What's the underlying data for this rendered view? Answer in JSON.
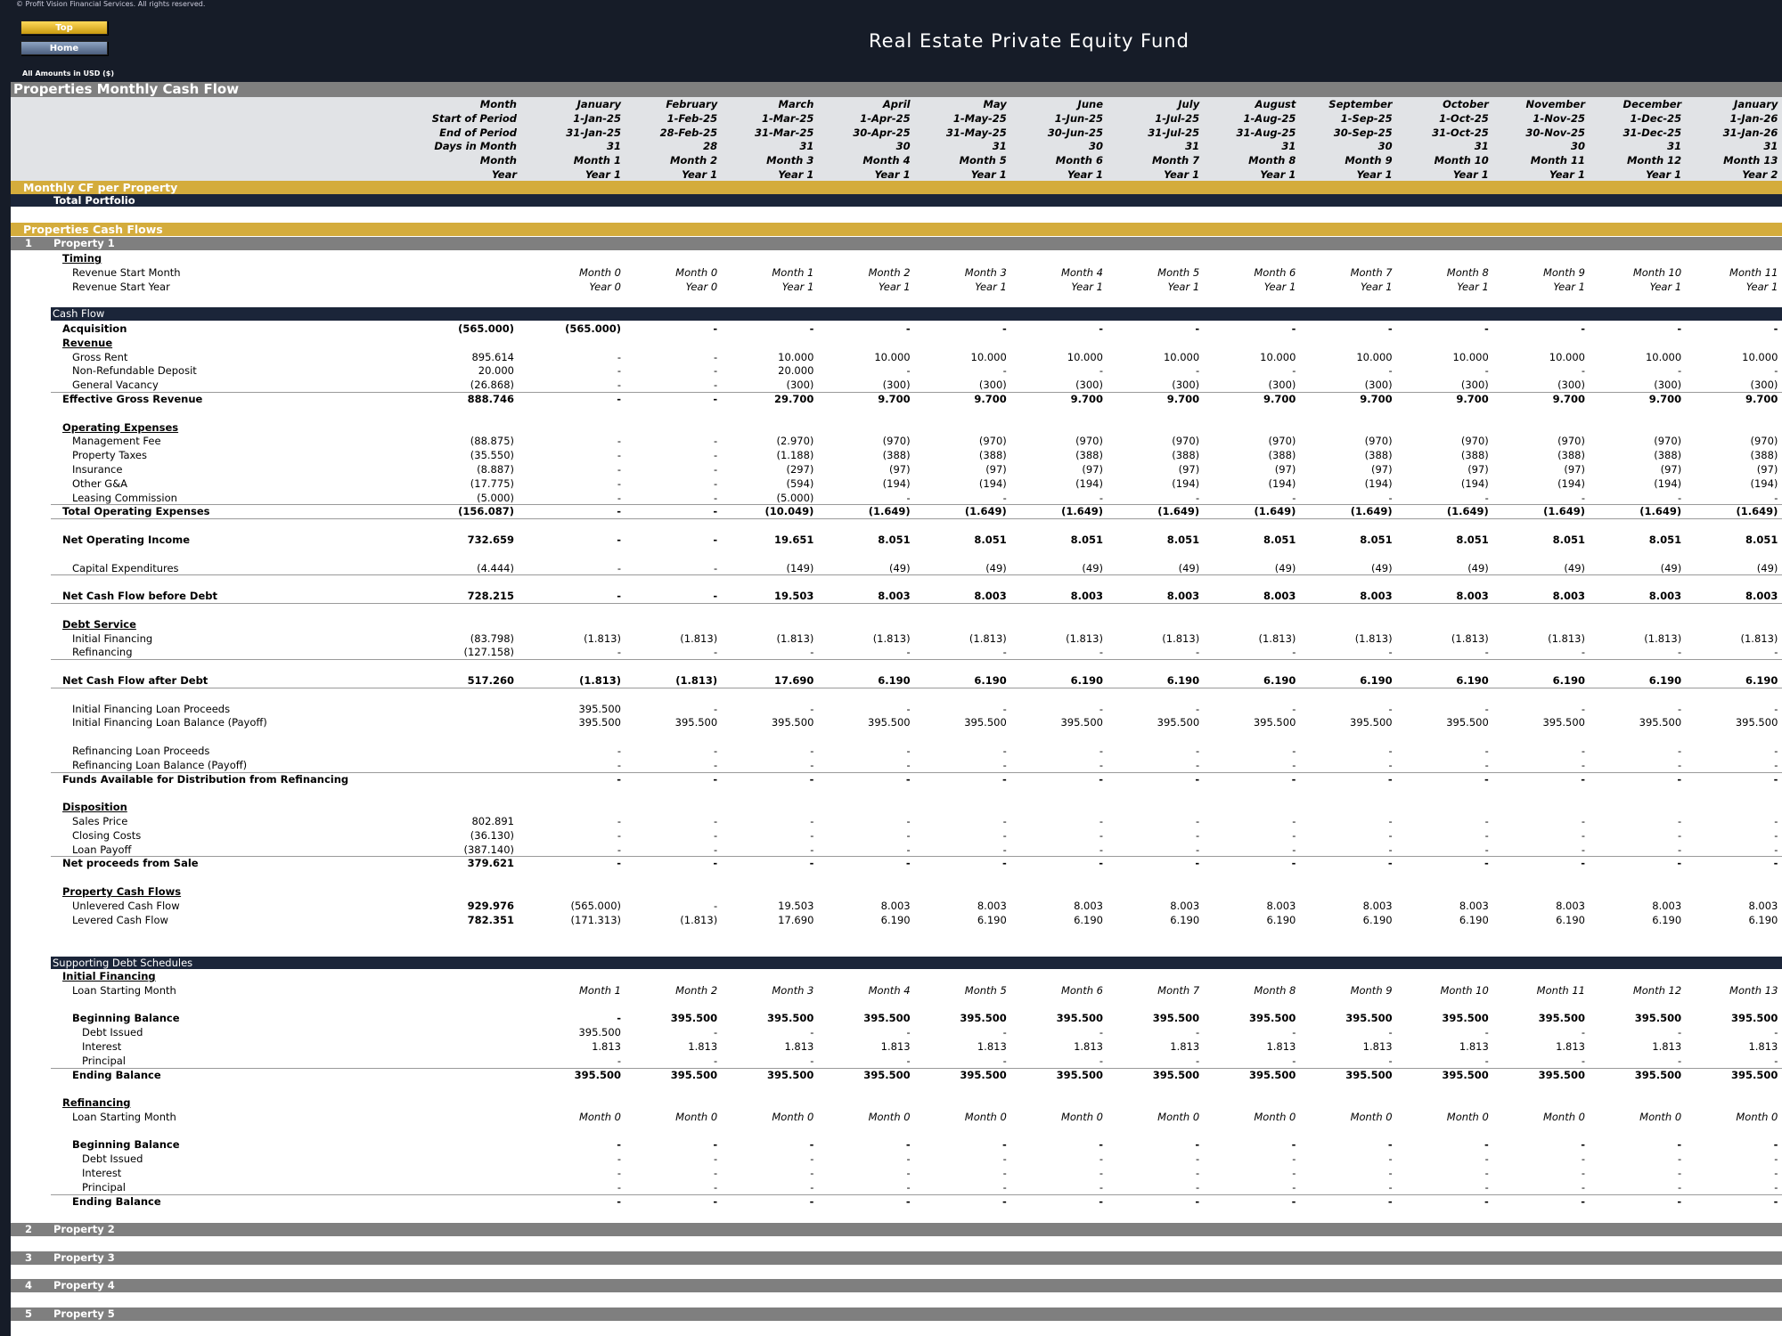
{
  "copyright": "© Profit Vision Financial Services. All rights reserved.",
  "nav": {
    "top": "Top",
    "home": "Home"
  },
  "title": "Real Estate Private Equity Fund",
  "amounts_note": "All Amounts in  USD ($)",
  "section_title": "Properties Monthly Cash Flow",
  "header_rows": [
    {
      "label": "Month",
      "values": [
        "January",
        "February",
        "March",
        "April",
        "May",
        "June",
        "July",
        "August",
        "September",
        "October",
        "November",
        "December",
        "January"
      ]
    },
    {
      "label": "Start of Period",
      "values": [
        "1-Jan-25",
        "1-Feb-25",
        "1-Mar-25",
        "1-Apr-25",
        "1-May-25",
        "1-Jun-25",
        "1-Jul-25",
        "1-Aug-25",
        "1-Sep-25",
        "1-Oct-25",
        "1-Nov-25",
        "1-Dec-25",
        "1-Jan-26"
      ]
    },
    {
      "label": "End of Period",
      "values": [
        "31-Jan-25",
        "28-Feb-25",
        "31-Mar-25",
        "30-Apr-25",
        "31-May-25",
        "30-Jun-25",
        "31-Jul-25",
        "31-Aug-25",
        "30-Sep-25",
        "31-Oct-25",
        "30-Nov-25",
        "31-Dec-25",
        "31-Jan-26"
      ]
    },
    {
      "label": "Days in Month",
      "values": [
        "31",
        "28",
        "31",
        "30",
        "31",
        "30",
        "31",
        "31",
        "30",
        "31",
        "30",
        "31",
        "31"
      ]
    },
    {
      "label": "Month",
      "values": [
        "Month 1",
        "Month 2",
        "Month 3",
        "Month 4",
        "Month 5",
        "Month 6",
        "Month 7",
        "Month 8",
        "Month 9",
        "Month 10",
        "Month 11",
        "Month 12",
        "Month 13"
      ]
    },
    {
      "label": "Year",
      "values": [
        "Year 1",
        "Year 1",
        "Year 1",
        "Year 1",
        "Year 1",
        "Year 1",
        "Year 1",
        "Year 1",
        "Year 1",
        "Year 1",
        "Year 1",
        "Year 1",
        "Year 2"
      ]
    }
  ],
  "monthly_cf_title": "Monthly CF per Property",
  "total_portfolio": "Total Portfolio",
  "properties_cf_title": "Properties Cash Flows",
  "property1": {
    "num": "1",
    "name": "Property 1"
  },
  "timing": {
    "title": "Timing",
    "rows": [
      {
        "label": "Revenue Start Month",
        "values": [
          "Month 0",
          "Month 0",
          "Month 1",
          "Month 2",
          "Month 3",
          "Month 4",
          "Month 5",
          "Month 6",
          "Month 7",
          "Month 8",
          "Month 9",
          "Month 10",
          "Month 11"
        ]
      },
      {
        "label": "Revenue Start Year",
        "values": [
          "Year 0",
          "Year 0",
          "Year 1",
          "Year 1",
          "Year 1",
          "Year 1",
          "Year 1",
          "Year 1",
          "Year 1",
          "Year 1",
          "Year 1",
          "Year 1",
          "Year 1"
        ]
      }
    ]
  },
  "cash_flow_title": "Cash Flow",
  "cf_rows": [
    {
      "label": "Acquisition",
      "style": "bold0",
      "total": "(565.000)",
      "values": [
        "(565.000)",
        "-",
        "-",
        "-",
        "-",
        "-",
        "-",
        "-",
        "-",
        "-",
        "-",
        "-",
        "-"
      ]
    },
    {
      "label": "Revenue",
      "style": "sub"
    },
    {
      "label": "Gross Rent",
      "style": "ind",
      "total": "895.614",
      "values": [
        "-",
        "-",
        "10.000",
        "10.000",
        "10.000",
        "10.000",
        "10.000",
        "10.000",
        "10.000",
        "10.000",
        "10.000",
        "10.000",
        "10.000"
      ]
    },
    {
      "label": "Non-Refundable Deposit",
      "style": "ind",
      "total": "20.000",
      "values": [
        "-",
        "-",
        "20.000",
        "-",
        "-",
        "-",
        "-",
        "-",
        "-",
        "-",
        "-",
        "-",
        "-"
      ]
    },
    {
      "label": "General Vacancy",
      "style": "ind ul",
      "total": "(26.868)",
      "values": [
        "-",
        "-",
        "(300)",
        "(300)",
        "(300)",
        "(300)",
        "(300)",
        "(300)",
        "(300)",
        "(300)",
        "(300)",
        "(300)",
        "(300)"
      ]
    },
    {
      "label": "Effective Gross Revenue",
      "style": "bold",
      "total": "888.746",
      "values": [
        "-",
        "-",
        "29.700",
        "9.700",
        "9.700",
        "9.700",
        "9.700",
        "9.700",
        "9.700",
        "9.700",
        "9.700",
        "9.700",
        "9.700"
      ]
    },
    {
      "label": "",
      "style": "blank"
    },
    {
      "label": "Operating Expenses",
      "style": "sub"
    },
    {
      "label": "Management Fee",
      "style": "ind",
      "total": "(88.875)",
      "values": [
        "-",
        "-",
        "(2.970)",
        "(970)",
        "(970)",
        "(970)",
        "(970)",
        "(970)",
        "(970)",
        "(970)",
        "(970)",
        "(970)",
        "(970)"
      ]
    },
    {
      "label": "Property Taxes",
      "style": "ind",
      "total": "(35.550)",
      "values": [
        "-",
        "-",
        "(1.188)",
        "(388)",
        "(388)",
        "(388)",
        "(388)",
        "(388)",
        "(388)",
        "(388)",
        "(388)",
        "(388)",
        "(388)"
      ]
    },
    {
      "label": "Insurance",
      "style": "ind",
      "total": "(8.887)",
      "values": [
        "-",
        "-",
        "(297)",
        "(97)",
        "(97)",
        "(97)",
        "(97)",
        "(97)",
        "(97)",
        "(97)",
        "(97)",
        "(97)",
        "(97)"
      ]
    },
    {
      "label": "Other G&A",
      "style": "ind",
      "total": "(17.775)",
      "values": [
        "-",
        "-",
        "(594)",
        "(194)",
        "(194)",
        "(194)",
        "(194)",
        "(194)",
        "(194)",
        "(194)",
        "(194)",
        "(194)",
        "(194)"
      ]
    },
    {
      "label": "Leasing Commission",
      "style": "ind ul",
      "total": "(5.000)",
      "values": [
        "-",
        "-",
        "(5.000)",
        "-",
        "-",
        "-",
        "-",
        "-",
        "-",
        "-",
        "-",
        "-",
        "-"
      ]
    },
    {
      "label": "Total Operating Expenses",
      "style": "bold ul",
      "total": "(156.087)",
      "values": [
        "-",
        "-",
        "(10.049)",
        "(1.649)",
        "(1.649)",
        "(1.649)",
        "(1.649)",
        "(1.649)",
        "(1.649)",
        "(1.649)",
        "(1.649)",
        "(1.649)",
        "(1.649)"
      ]
    },
    {
      "label": "",
      "style": "blank"
    },
    {
      "label": "Net Operating Income",
      "style": "bold",
      "total": "732.659",
      "values": [
        "-",
        "-",
        "19.651",
        "8.051",
        "8.051",
        "8.051",
        "8.051",
        "8.051",
        "8.051",
        "8.051",
        "8.051",
        "8.051",
        "8.051"
      ]
    },
    {
      "label": "",
      "style": "blank"
    },
    {
      "label": "Capital Expenditures",
      "style": "ind ul",
      "total": "(4.444)",
      "values": [
        "-",
        "-",
        "(149)",
        "(49)",
        "(49)",
        "(49)",
        "(49)",
        "(49)",
        "(49)",
        "(49)",
        "(49)",
        "(49)",
        "(49)"
      ]
    },
    {
      "label": "",
      "style": "blank"
    },
    {
      "label": "Net Cash Flow before Debt",
      "style": "bold ul",
      "total": "728.215",
      "values": [
        "-",
        "-",
        "19.503",
        "8.003",
        "8.003",
        "8.003",
        "8.003",
        "8.003",
        "8.003",
        "8.003",
        "8.003",
        "8.003",
        "8.003"
      ]
    },
    {
      "label": "",
      "style": "blank"
    },
    {
      "label": "Debt Service",
      "style": "sub"
    },
    {
      "label": "Initial Financing",
      "style": "ind",
      "total": "(83.798)",
      "values": [
        "(1.813)",
        "(1.813)",
        "(1.813)",
        "(1.813)",
        "(1.813)",
        "(1.813)",
        "(1.813)",
        "(1.813)",
        "(1.813)",
        "(1.813)",
        "(1.813)",
        "(1.813)",
        "(1.813)"
      ]
    },
    {
      "label": "Refinancing",
      "style": "ind ul",
      "total": "(127.158)",
      "values": [
        "-",
        "-",
        "-",
        "-",
        "-",
        "-",
        "-",
        "-",
        "-",
        "-",
        "-",
        "-",
        "-"
      ]
    },
    {
      "label": "",
      "style": "blank"
    },
    {
      "label": "Net Cash Flow after Debt",
      "style": "bold ul",
      "total": "517.260",
      "values": [
        "(1.813)",
        "(1.813)",
        "17.690",
        "6.190",
        "6.190",
        "6.190",
        "6.190",
        "6.190",
        "6.190",
        "6.190",
        "6.190",
        "6.190",
        "6.190"
      ]
    },
    {
      "label": "",
      "style": "blank"
    },
    {
      "label": "Initial Financing Loan Proceeds",
      "style": "ind",
      "total": "",
      "values": [
        "395.500",
        "-",
        "-",
        "-",
        "-",
        "-",
        "-",
        "-",
        "-",
        "-",
        "-",
        "-",
        "-"
      ]
    },
    {
      "label": "Initial Financing Loan Balance (Payoff)",
      "style": "ind",
      "total": "",
      "values": [
        "395.500",
        "395.500",
        "395.500",
        "395.500",
        "395.500",
        "395.500",
        "395.500",
        "395.500",
        "395.500",
        "395.500",
        "395.500",
        "395.500",
        "395.500"
      ]
    },
    {
      "label": "",
      "style": "blank"
    },
    {
      "label": "Refinancing Loan Proceeds",
      "style": "ind",
      "total": "",
      "values": [
        "-",
        "-",
        "-",
        "-",
        "-",
        "-",
        "-",
        "-",
        "-",
        "-",
        "-",
        "-",
        "-"
      ]
    },
    {
      "label": "Refinancing Loan Balance (Payoff)",
      "style": "ind ul",
      "total": "",
      "values": [
        "-",
        "-",
        "-",
        "-",
        "-",
        "-",
        "-",
        "-",
        "-",
        "-",
        "-",
        "-",
        "-"
      ]
    },
    {
      "label": "Funds Available for Distribution from Refinancing",
      "style": "bold",
      "total": "",
      "values": [
        "-",
        "-",
        "-",
        "-",
        "-",
        "-",
        "-",
        "-",
        "-",
        "-",
        "-",
        "-",
        "-"
      ]
    },
    {
      "label": "",
      "style": "blank"
    },
    {
      "label": "Disposition",
      "style": "sub"
    },
    {
      "label": "Sales Price",
      "style": "ind",
      "total": "802.891",
      "values": [
        "-",
        "-",
        "-",
        "-",
        "-",
        "-",
        "-",
        "-",
        "-",
        "-",
        "-",
        "-",
        "-"
      ]
    },
    {
      "label": "Closing Costs",
      "style": "ind",
      "total": "(36.130)",
      "values": [
        "-",
        "-",
        "-",
        "-",
        "-",
        "-",
        "-",
        "-",
        "-",
        "-",
        "-",
        "-",
        "-"
      ]
    },
    {
      "label": "Loan Payoff",
      "style": "ind ul",
      "total": "(387.140)",
      "values": [
        "-",
        "-",
        "-",
        "-",
        "-",
        "-",
        "-",
        "-",
        "-",
        "-",
        "-",
        "-",
        "-"
      ]
    },
    {
      "label": "Net proceeds from Sale",
      "style": "bold",
      "total": "379.621",
      "values": [
        "-",
        "-",
        "-",
        "-",
        "-",
        "-",
        "-",
        "-",
        "-",
        "-",
        "-",
        "-",
        "-"
      ]
    },
    {
      "label": "",
      "style": "blank"
    },
    {
      "label": "Property Cash Flows",
      "style": "sub"
    },
    {
      "label": "Unlevered Cash Flow",
      "style": "ind",
      "total": "929.976",
      "totalBold": true,
      "values": [
        "(565.000)",
        "-",
        "19.503",
        "8.003",
        "8.003",
        "8.003",
        "8.003",
        "8.003",
        "8.003",
        "8.003",
        "8.003",
        "8.003",
        "8.003"
      ]
    },
    {
      "label": "Levered Cash Flow",
      "style": "ind",
      "total": "782.351",
      "totalBold": true,
      "values": [
        "(171.313)",
        "(1.813)",
        "17.690",
        "6.190",
        "6.190",
        "6.190",
        "6.190",
        "6.190",
        "6.190",
        "6.190",
        "6.190",
        "6.190",
        "6.190"
      ]
    }
  ],
  "supporting_title": "Supporting Debt Schedules",
  "debt_schedules": [
    {
      "title": "Initial Financing",
      "start_label": "Loan Starting Month",
      "start_values": [
        "Month 1",
        "Month 2",
        "Month 3",
        "Month 4",
        "Month 5",
        "Month 6",
        "Month 7",
        "Month 8",
        "Month 9",
        "Month 10",
        "Month 11",
        "Month 12",
        "Month 13"
      ],
      "rows": [
        {
          "label": "Beginning Balance",
          "style": "bold ind",
          "values": [
            "-",
            "395.500",
            "395.500",
            "395.500",
            "395.500",
            "395.500",
            "395.500",
            "395.500",
            "395.500",
            "395.500",
            "395.500",
            "395.500",
            "395.500"
          ]
        },
        {
          "label": "Debt Issued",
          "style": "ind2",
          "values": [
            "395.500",
            "-",
            "-",
            "-",
            "-",
            "-",
            "-",
            "-",
            "-",
            "-",
            "-",
            "-",
            "-"
          ]
        },
        {
          "label": "Interest",
          "style": "ind2",
          "values": [
            "1.813",
            "1.813",
            "1.813",
            "1.813",
            "1.813",
            "1.813",
            "1.813",
            "1.813",
            "1.813",
            "1.813",
            "1.813",
            "1.813",
            "1.813"
          ]
        },
        {
          "label": "Principal",
          "style": "ind2 ul",
          "values": [
            "-",
            "-",
            "-",
            "-",
            "-",
            "-",
            "-",
            "-",
            "-",
            "-",
            "-",
            "-",
            "-"
          ]
        },
        {
          "label": "Ending Balance",
          "style": "bold ind",
          "values": [
            "395.500",
            "395.500",
            "395.500",
            "395.500",
            "395.500",
            "395.500",
            "395.500",
            "395.500",
            "395.500",
            "395.500",
            "395.500",
            "395.500",
            "395.500"
          ]
        }
      ]
    },
    {
      "title": "Refinancing",
      "start_label": "Loan Starting Month",
      "start_values": [
        "Month 0",
        "Month 0",
        "Month 0",
        "Month 0",
        "Month 0",
        "Month 0",
        "Month 0",
        "Month 0",
        "Month 0",
        "Month 0",
        "Month 0",
        "Month 0",
        "Month 0"
      ],
      "rows": [
        {
          "label": "Beginning Balance",
          "style": "bold ind",
          "values": [
            "-",
            "-",
            "-",
            "-",
            "-",
            "-",
            "-",
            "-",
            "-",
            "-",
            "-",
            "-",
            "-"
          ]
        },
        {
          "label": "Debt Issued",
          "style": "ind2",
          "values": [
            "-",
            "-",
            "-",
            "-",
            "-",
            "-",
            "-",
            "-",
            "-",
            "-",
            "-",
            "-",
            "-"
          ]
        },
        {
          "label": "Interest",
          "style": "ind2",
          "values": [
            "-",
            "-",
            "-",
            "-",
            "-",
            "-",
            "-",
            "-",
            "-",
            "-",
            "-",
            "-",
            "-"
          ]
        },
        {
          "label": "Principal",
          "style": "ind2 ul",
          "values": [
            "-",
            "-",
            "-",
            "-",
            "-",
            "-",
            "-",
            "-",
            "-",
            "-",
            "-",
            "-",
            "-"
          ]
        },
        {
          "label": "Ending Balance",
          "style": "bold ind",
          "values": [
            "-",
            "-",
            "-",
            "-",
            "-",
            "-",
            "-",
            "-",
            "-",
            "-",
            "-",
            "-",
            "-"
          ]
        }
      ]
    }
  ],
  "other_properties": [
    {
      "num": "2",
      "name": "Property 2"
    },
    {
      "num": "3",
      "name": "Property 3"
    },
    {
      "num": "4",
      "name": "Property 4"
    },
    {
      "num": "5",
      "name": "Property 5"
    }
  ],
  "colors": {
    "navy": "#161c28",
    "gold": "#d4ac3c",
    "grey": "#7f7f7f",
    "header_grey": "#e1e3e6"
  }
}
